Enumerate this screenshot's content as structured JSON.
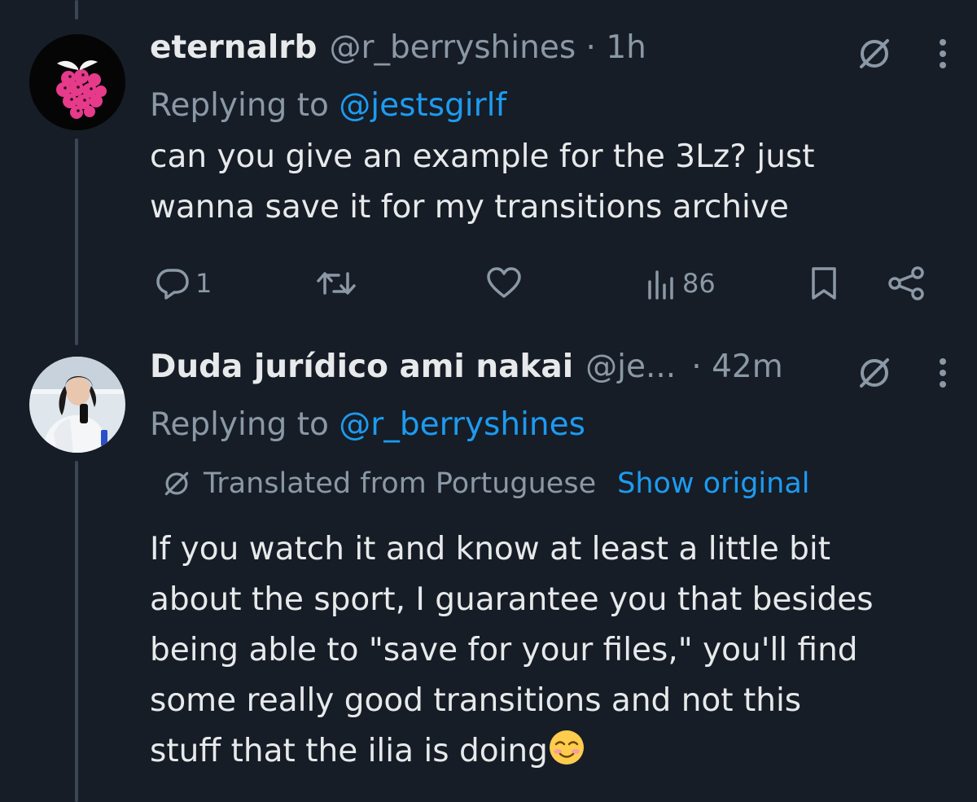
{
  "tweets": [
    {
      "display_name": "eternalrb",
      "handle": "@r_berryshines",
      "time": " · 1h",
      "replying_label": "Replying to ",
      "replying_to": "@jestsgirlf",
      "text_lines": [
        "can you give an example for the 3Lz? just",
        "wanna save it for my transitions archive"
      ],
      "actions": {
        "reply_count": "1",
        "retweet_count": "",
        "like_count": "",
        "view_count": "86"
      }
    },
    {
      "display_name": "Duda jurídico ami nakai",
      "handle": "@je...",
      "time": " · 42m",
      "replying_label": "Replying to ",
      "replying_to": "@r_berryshines",
      "translated_label": "Translated from Portuguese",
      "show_original_label": "Show original",
      "text_lines": [
        "If you watch it and know at least a little bit",
        "about the sport, I guarantee you that besides",
        "being able to \"save for your files,\" you'll find",
        "some really good transitions and not this",
        "stuff that the ilia is doing"
      ],
      "trailing_emoji": "smiling-face-with-blush"
    }
  ],
  "colors": {
    "background": "#161d27",
    "text_primary": "#e7e9ea",
    "text_secondary": "#8b98a5",
    "link": "#1d9bf0",
    "thread_line": "#3a4654",
    "raspberry": "#e63a8a"
  },
  "icons": [
    "raspberry-avatar",
    "grok-icon",
    "more-icon",
    "reply-icon",
    "retweet-icon",
    "like-icon",
    "views-icon",
    "bookmark-icon",
    "share-icon",
    "translate-icon"
  ]
}
